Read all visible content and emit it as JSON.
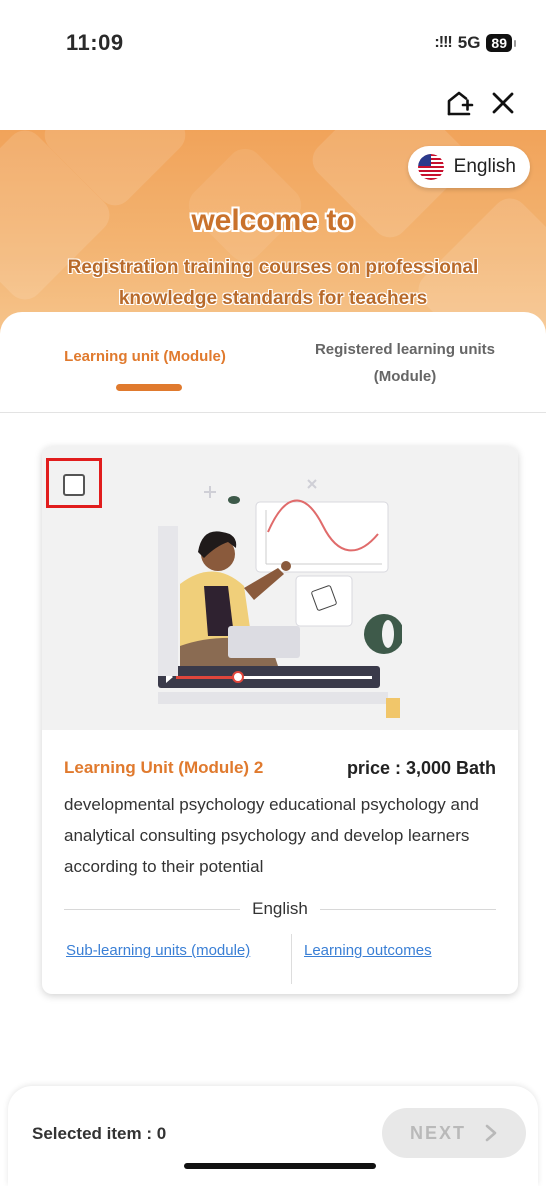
{
  "status_bar": {
    "time": "11:09",
    "signal": ":!!!",
    "network": "5G",
    "battery": "89"
  },
  "hero": {
    "language": "English",
    "welcome": "welcome to",
    "subtitle_line1": "Registration training courses on professional",
    "subtitle_line2": "knowledge standards for teachers"
  },
  "tabs": [
    {
      "label": "Learning unit (Module)"
    },
    {
      "label_line1": "Registered learning units",
      "label_line2": "(Module)"
    }
  ],
  "card": {
    "title": "Learning Unit (Module) 2",
    "price": "price : 3,000 Bath",
    "description": "developmental psychology educational psychology and analytical consulting psychology and develop learners according to their potential",
    "language": "English",
    "link_sub": "Sub-learning units (module)",
    "link_outcomes": "Learning outcomes"
  },
  "footer": {
    "selected": "Selected item : 0",
    "next": "NEXT"
  },
  "colors": {
    "accent": "#e07a2e",
    "highlight": "#e11d1d",
    "link": "#3a7fd5"
  }
}
